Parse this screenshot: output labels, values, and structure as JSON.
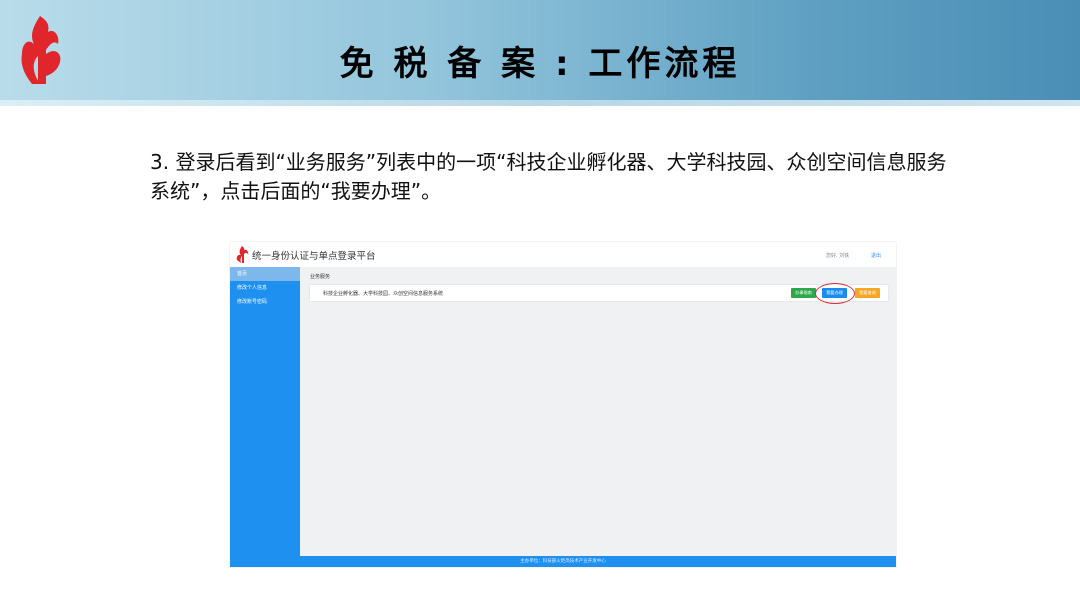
{
  "slide": {
    "title": "免 税 备 案 : 工作流程",
    "instruction": "3. 登录后看到“业务服务”列表中的一项“科技企业孵化器、大学科技园、众创空间信息服务系统”，点击后面的“我要办理”。"
  },
  "app": {
    "title": "统一身份认证与单点登录平台",
    "user_text": "您好, 刘铁",
    "logout_label": "退出",
    "sidebar": [
      {
        "label": "首页"
      },
      {
        "label": "修改个人信息"
      },
      {
        "label": "修改账号密码"
      }
    ],
    "section_title": "业务服务",
    "service": {
      "name": "科技企业孵化器、大学科技园、众创空间信息服务系统",
      "buttons": [
        {
          "label": "办事指南",
          "color": "#2aa84a"
        },
        {
          "label": "我要办理",
          "color": "#1a8cf0"
        },
        {
          "label": "我要查询",
          "color": "#f5a623"
        }
      ]
    },
    "footer": "主办单位：科技部火炬高技术产业开发中心"
  },
  "colors": {
    "accent": "#1e90f0",
    "highlight": "#d0303a",
    "logo": "#e0262a"
  }
}
